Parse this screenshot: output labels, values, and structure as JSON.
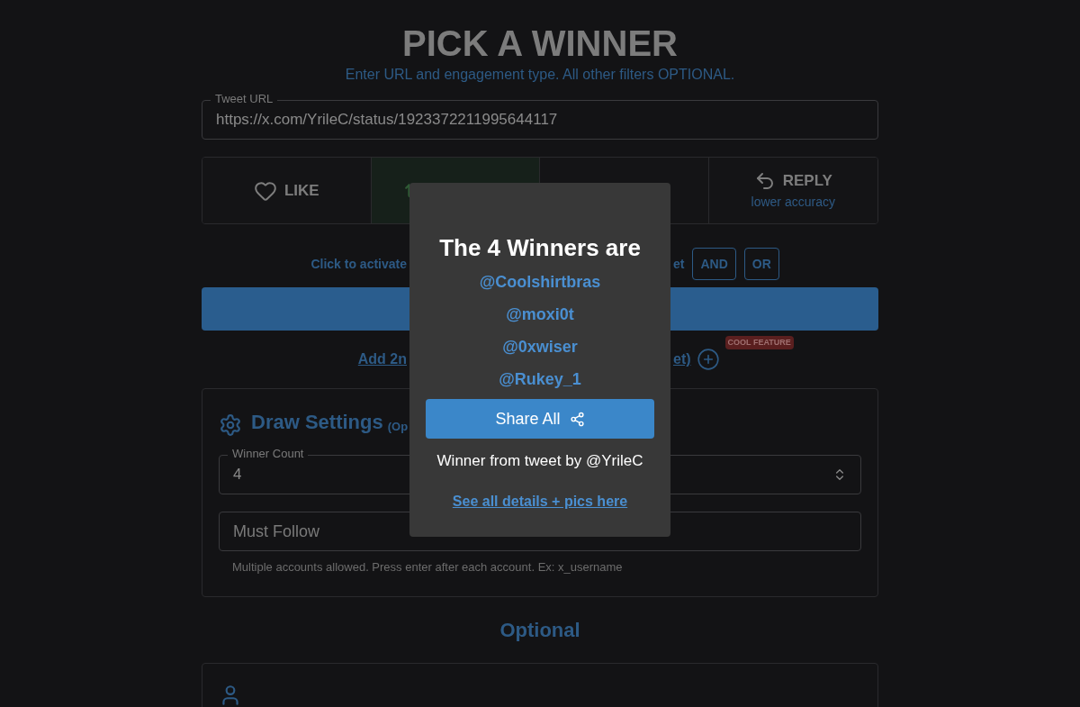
{
  "header": {
    "title": "PICK A WINNER",
    "subtitle": "Enter URL and engagement type. All other filters OPTIONAL."
  },
  "url_field": {
    "label": "Tweet URL",
    "value": "https://x.com/YrileC/status/1923372211995644117"
  },
  "engagement_tiles": [
    {
      "kind": "like",
      "label": "LIKE",
      "selected": false
    },
    {
      "kind": "retweet",
      "selected": true
    },
    {
      "kind": "hidden",
      "selected": false
    },
    {
      "kind": "reply",
      "label": "REPLY",
      "note": "lower accuracy",
      "selected": false
    }
  ],
  "activate_row": {
    "text_left": "Click to activate",
    "text_right": "et",
    "operators": [
      {
        "label": "AND",
        "selected": false
      },
      {
        "label": "OR",
        "selected": false
      }
    ]
  },
  "add_row": {
    "text_left": "Add 2n",
    "text_right": "et)",
    "badge": "COOL FEATURE"
  },
  "draw_settings": {
    "title": "Draw Settings",
    "title_suffix": "(Op",
    "winner_count": {
      "label": "Winner Count",
      "value": "4"
    },
    "must_follow": {
      "placeholder": "Must Follow",
      "helper": "Multiple accounts allowed. Press enter after each account. Ex: x_username"
    }
  },
  "optional_heading": "Optional",
  "modal": {
    "title": "The 4 Winners are",
    "winners": [
      "@Coolshirtbras",
      "@moxi0t",
      "@0xwiser",
      "@Rukey_1"
    ],
    "share_button": "Share All",
    "source": "Winner from tweet by @YrileC",
    "details_link": "See all details + pics here"
  }
}
